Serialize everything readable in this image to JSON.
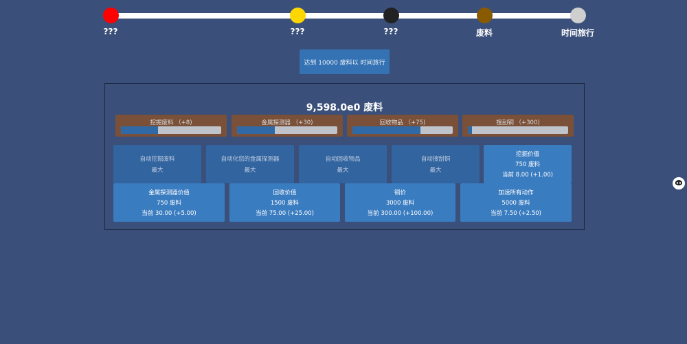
{
  "colors": {
    "background": "#3a4f79",
    "track": "#ffffff",
    "node_1": "#ff0000",
    "node_2": "#ffd700",
    "node_3": "#222222",
    "node_4": "#8a5a00",
    "node_5": "#cfcfcf",
    "gatherer_bg": "#7a5038",
    "gatherer_fill": "#2f6aa7",
    "maxed_card": "#3264a0",
    "buy_card": "#3a7cc0"
  },
  "timeline": {
    "nodes": [
      {
        "label": "???"
      },
      {
        "label": "???"
      },
      {
        "label": "???"
      },
      {
        "label": "废料"
      },
      {
        "label": "时间旅行"
      }
    ]
  },
  "time_travel_button": "达到 10000 废料以 时间旅行",
  "resource": {
    "amount": "9,598.0e0 废料"
  },
  "gatherers": [
    {
      "label": "挖掘废料 （+8)",
      "progress": 0.37
    },
    {
      "label": "金属探测器 （+30)",
      "progress": 0.38
    },
    {
      "label": "回收物品 （+75)",
      "progress": 0.68
    },
    {
      "label": "搜刮铜 （+300)",
      "progress": 0.04
    }
  ],
  "automation": [
    {
      "title": "自动挖掘废料",
      "status": "最大"
    },
    {
      "title": "自动化您的金属探测器",
      "status": "最大"
    },
    {
      "title": "自动回收物品",
      "status": "最大"
    },
    {
      "title": "自动搜刮铜",
      "status": "最大"
    }
  ],
  "upgrades": [
    {
      "title": "挖掘价值",
      "cost": "750 废料",
      "current": "当前 8.00 (+1.00)"
    },
    {
      "title": "金属探测器价值",
      "cost": "750 废料",
      "current": "当前 30.00 (+5.00)"
    },
    {
      "title": "回收价值",
      "cost": "1500 废料",
      "current": "当前 75.00 (+25.00)"
    },
    {
      "title": "铜价",
      "cost": "3000 废料",
      "current": "当前 300.00 (+100.00)"
    },
    {
      "title": "加速所有动作",
      "cost": "5000 废料",
      "current": "当前 7.50 (+2.50)"
    }
  ],
  "side_icon": "helper-avatar-icon"
}
